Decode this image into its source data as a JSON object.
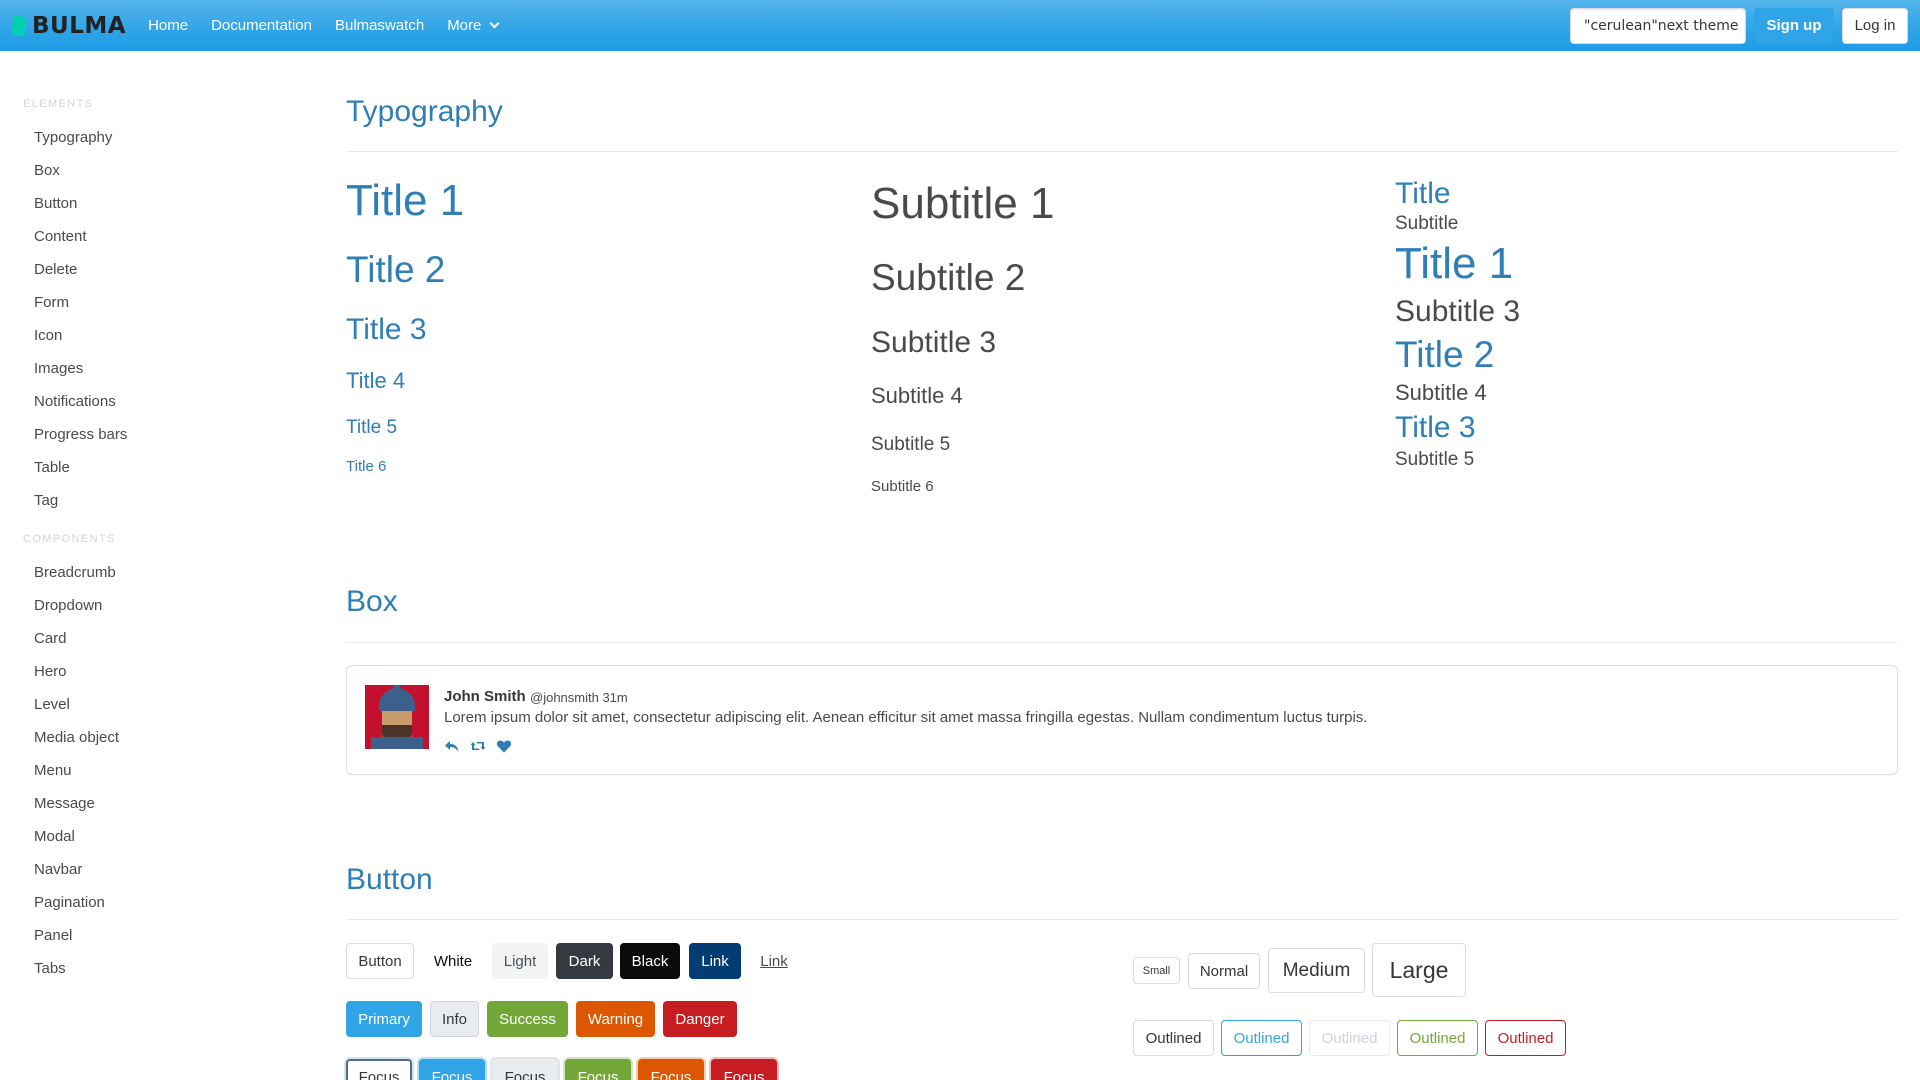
{
  "navbar": {
    "brand": "BULMA",
    "items": [
      "Home",
      "Documentation",
      "Bulmaswatch",
      "More"
    ],
    "theme_value": "\"cerulean\"next theme",
    "signup_label": "Sign up",
    "login_label": "Log in",
    "color": "#2fa4e7"
  },
  "sidebar": {
    "elements_label": "ELEMENTS",
    "elements": [
      "Typography",
      "Box",
      "Button",
      "Content",
      "Delete",
      "Form",
      "Icon",
      "Images",
      "Notifications",
      "Progress bars",
      "Table",
      "Tag"
    ],
    "components_label": "COMPONENTS",
    "components": [
      "Breadcrumb",
      "Dropdown",
      "Card",
      "Hero",
      "Level",
      "Media object",
      "Menu",
      "Message",
      "Modal",
      "Navbar",
      "Pagination",
      "Panel",
      "Tabs"
    ]
  },
  "typography": {
    "heading": "Typography",
    "titles": [
      "Title 1",
      "Title 2",
      "Title 3",
      "Title 4",
      "Title 5",
      "Title 6"
    ],
    "subtitles": [
      "Subtitle 1",
      "Subtitle 2",
      "Subtitle 3",
      "Subtitle 4",
      "Subtitle 5",
      "Subtitle 6"
    ],
    "pairs": [
      "Title",
      "Subtitle",
      "Title 1",
      "Subtitle 3",
      "Title 2",
      "Subtitle 4",
      "Title 3",
      "Subtitle 5"
    ]
  },
  "box": {
    "heading": "Box",
    "name": "John Smith",
    "handle": "@johnsmith 31m",
    "text": "Lorem ipsum dolor sit amet, consectetur adipiscing elit. Aenean efficitur sit amet massa fringilla egestas. Nullam condimentum luctus turpis."
  },
  "button": {
    "heading": "Button",
    "row1": [
      "Button",
      "White",
      "Light",
      "Dark",
      "Black",
      "Link",
      "Link"
    ],
    "row2": [
      "Primary",
      "Info",
      "Success",
      "Warning",
      "Danger"
    ],
    "focus": [
      "Focus",
      "Focus",
      "Focus",
      "Focus",
      "Focus",
      "Focus"
    ],
    "sizes": [
      "Small",
      "Normal",
      "Medium",
      "Large"
    ],
    "outlined": [
      "Outlined",
      "Outlined",
      "Outlined",
      "Outlined",
      "Outlined"
    ],
    "colors": {
      "primary": "#2fa4e7",
      "info": "#e9ecef",
      "success": "#73a839",
      "warning": "#dd5600",
      "danger": "#c71c22",
      "link": "#033c73",
      "dark": "#343a40"
    }
  }
}
